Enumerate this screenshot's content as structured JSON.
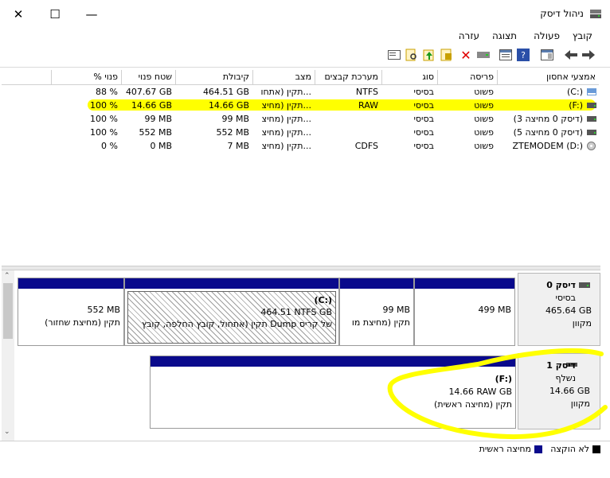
{
  "window": {
    "title": "ניהול דיסק",
    "minimize": "—",
    "maximize": "☐",
    "close": "✕"
  },
  "menu": [
    "קובץ",
    "פעולה",
    "תצוגה",
    "עזרה"
  ],
  "toolbar_icons": [
    "back-icon",
    "forward-icon",
    "properties-icon",
    "help-icon",
    "show-hide-console-icon",
    "connect-drive-icon",
    "delete-icon",
    "format-icon",
    "open-icon",
    "explore-icon",
    "refresh-icon"
  ],
  "volumes": {
    "headers": [
      "אמצעי אחסון",
      "פריסה",
      "סוג",
      "מערכת קבצים",
      "מצב",
      "קיבולת",
      "שטח פנוי",
      "% פנוי"
    ],
    "rows": [
      {
        "name": "(C:)",
        "layout": "פשוט",
        "type": "בסיסי",
        "fs": "NTFS",
        "status": "תקין (אתחו...",
        "capacity": "464.51 GB",
        "free": "407.67 GB",
        "pct": "88 %"
      },
      {
        "name": "(F:)",
        "layout": "פשוט",
        "type": "בסיסי",
        "fs": "RAW",
        "status": "תקין (מחיצ...",
        "capacity": "14.66 GB",
        "free": "14.66 GB",
        "pct": "100 %"
      },
      {
        "name": "(דיסק 0 מחיצה 3)",
        "layout": "פשוט",
        "type": "בסיסי",
        "fs": "",
        "status": "תקין (מחיצ...",
        "capacity": "99 MB",
        "free": "99 MB",
        "pct": "100 %"
      },
      {
        "name": "(דיסק 0 מחיצה 5)",
        "layout": "פשוט",
        "type": "בסיסי",
        "fs": "",
        "status": "תקין (מחיצ...",
        "capacity": "552 MB",
        "free": "552 MB",
        "pct": "100 %"
      },
      {
        "name": "ZTEMODEM (D:)",
        "layout": "פשוט",
        "type": "בסיסי",
        "fs": "CDFS",
        "status": "תקין (מחיצ...",
        "capacity": "7 MB",
        "free": "0 MB",
        "pct": "0 %"
      }
    ]
  },
  "disk0": {
    "name": "דיסק 0",
    "type": "בסיסי",
    "size": "465.64 GB",
    "state": "מקוון",
    "partitions": [
      {
        "size": "499 MB",
        "status": ""
      },
      {
        "size": "99 MB",
        "status": "תקין (מחיצת מו"
      },
      {
        "title": "(C:)",
        "size": "464.51 NTFS GB",
        "status": "תקין (אתחול, קובץ החלפה, קובץ Dump של קריס"
      },
      {
        "size": "552 MB",
        "status": "תקין (מחיצת שחזור)"
      }
    ]
  },
  "disk1": {
    "name": "דיסק 1",
    "type": "נשלף",
    "size": "14.66 GB",
    "state": "מקוון",
    "partition": {
      "title": "(F:)",
      "size": "14.66 RAW GB",
      "status": "תקין (מחיצה ראשית)"
    }
  },
  "legend": [
    "לא הוקצה",
    "מחיצה ראשית"
  ],
  "colors": {
    "primary": "#0a0a8c",
    "unallocated": "#000000",
    "highlight": "#ffff00"
  }
}
